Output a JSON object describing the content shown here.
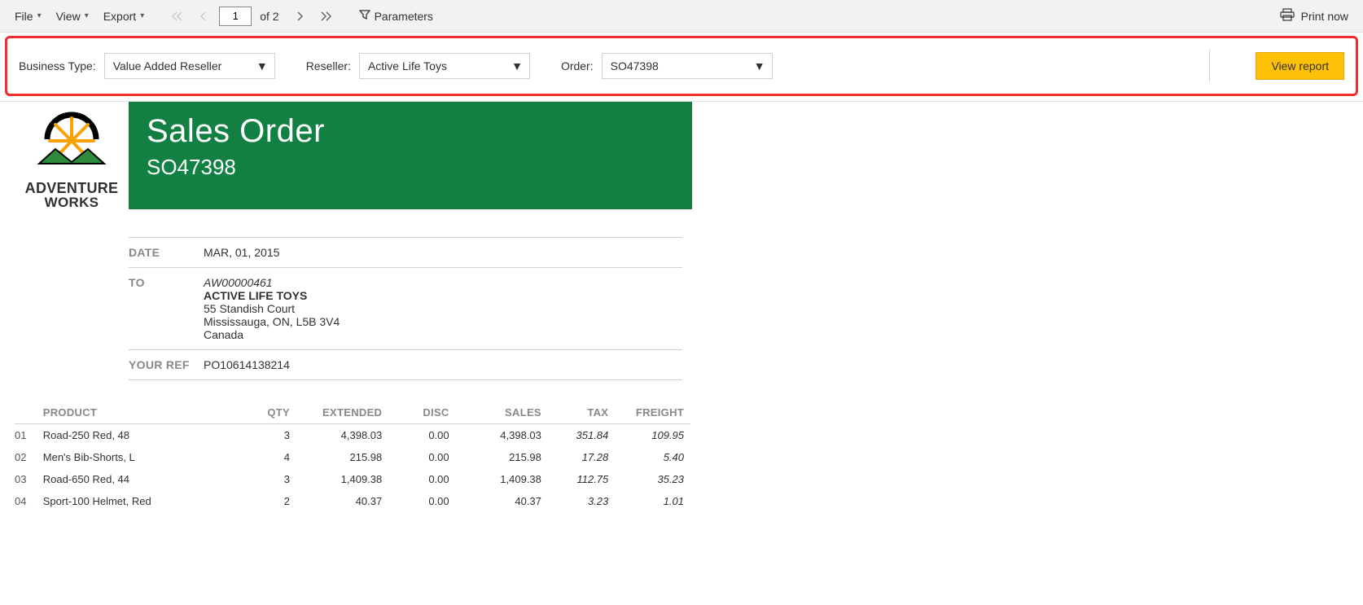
{
  "toolbar": {
    "file": "File",
    "view": "View",
    "export": "Export",
    "page_current": "1",
    "page_total": "of 2",
    "parameters": "Parameters",
    "print": "Print now"
  },
  "params": {
    "business_type_label": "Business Type:",
    "business_type_value": "Value Added Reseller",
    "reseller_label": "Reseller:",
    "reseller_value": "Active Life Toys",
    "order_label": "Order:",
    "order_value": "SO47398",
    "view_report": "View report"
  },
  "report": {
    "logo_top": "ADVENTURE",
    "logo_bottom": "WORKS",
    "title": "Sales Order",
    "order_no": "SO47398",
    "meta": {
      "date_label": "DATE",
      "date_value": "MAR, 01, 2015",
      "to_label": "TO",
      "to_code": "AW00000461",
      "to_name": "ACTIVE LIFE TOYS",
      "to_addr1": "55 Standish Court",
      "to_addr2": "Mississauga, ON, L5B 3V4",
      "to_country": "Canada",
      "ref_label": "YOUR REF",
      "ref_value": "PO10614138214"
    },
    "columns": {
      "product": "PRODUCT",
      "qty": "QTY",
      "extended": "EXTENDED",
      "disc": "DISC",
      "sales": "SALES",
      "tax": "TAX",
      "freight": "FREIGHT"
    },
    "rows": [
      {
        "idx": "01",
        "product": "Road-250 Red, 48",
        "qty": "3",
        "ext": "4,398.03",
        "disc": "0.00",
        "sales": "4,398.03",
        "tax": "351.84",
        "freight": "109.95"
      },
      {
        "idx": "02",
        "product": "Men's Bib-Shorts, L",
        "qty": "4",
        "ext": "215.98",
        "disc": "0.00",
        "sales": "215.98",
        "tax": "17.28",
        "freight": "5.40"
      },
      {
        "idx": "03",
        "product": "Road-650 Red, 44",
        "qty": "3",
        "ext": "1,409.38",
        "disc": "0.00",
        "sales": "1,409.38",
        "tax": "112.75",
        "freight": "35.23"
      },
      {
        "idx": "04",
        "product": "Sport-100 Helmet, Red",
        "qty": "2",
        "ext": "40.37",
        "disc": "0.00",
        "sales": "40.37",
        "tax": "3.23",
        "freight": "1.01"
      }
    ]
  }
}
